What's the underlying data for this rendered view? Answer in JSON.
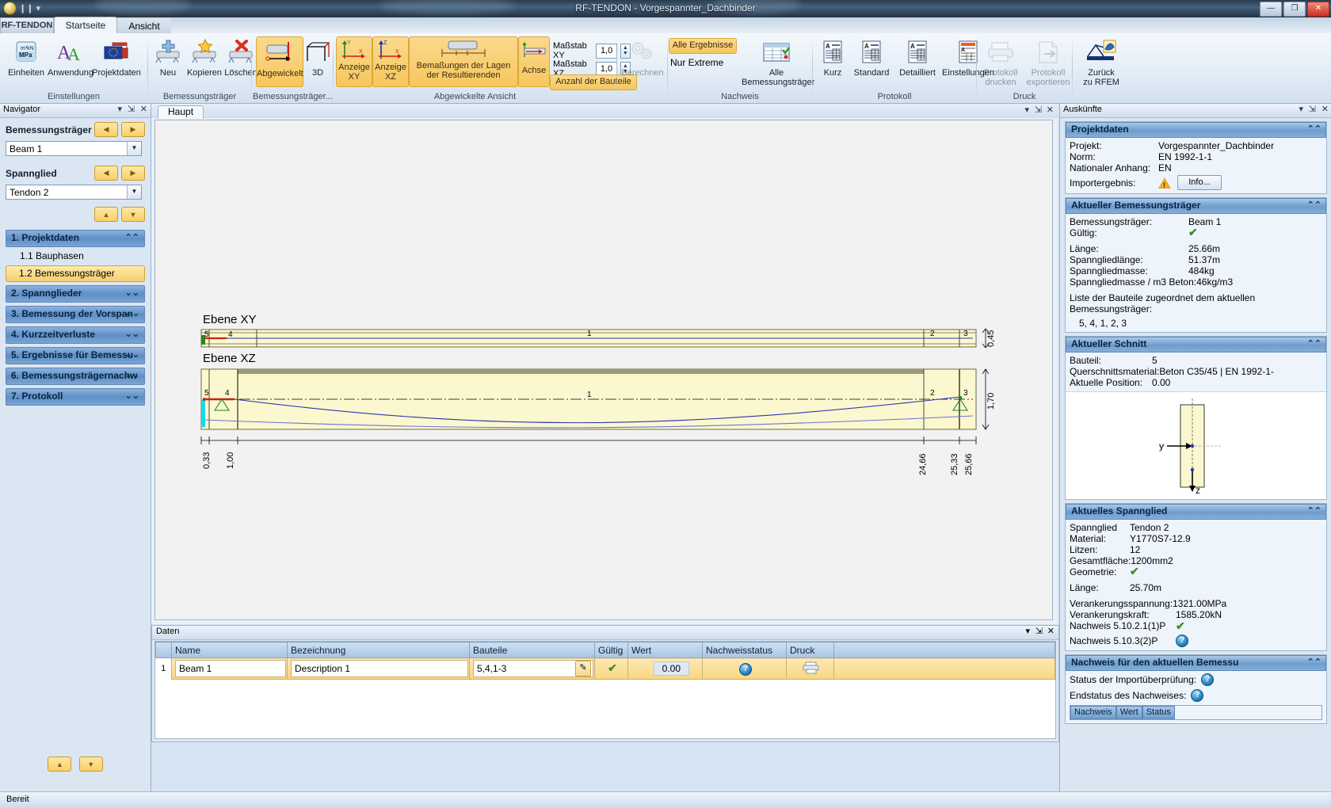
{
  "window": {
    "title": "RF-TENDON - Vorgespannter_Dachbinder",
    "minimize": "—",
    "maximize": "❐",
    "close": "✕"
  },
  "app_tab": "RF-TENDON",
  "tabs": [
    {
      "label": "Startseite",
      "active": true
    },
    {
      "label": "Ansicht",
      "active": false
    }
  ],
  "ribbon": {
    "groups": [
      {
        "label": "Einstellungen"
      },
      {
        "label": "Bemessungsträger"
      },
      {
        "label": "Bemessungsträger..."
      },
      {
        "label": "Abgewickelte Ansicht"
      },
      {
        "label": "Nachweis"
      },
      {
        "label": "Protokoll"
      },
      {
        "label": "Druck"
      }
    ],
    "einheiten": "Einheiten",
    "anwendung": "Anwendung",
    "projektdaten": "Projektdaten",
    "neu": "Neu",
    "kopieren": "Kopieren",
    "loeschen": "Löschen",
    "abgewickelt": "Abgewickelt",
    "dreid": "3D",
    "anzeige_xy": "Anzeige\nXY",
    "anzeige_xy_l1": "Anzeige",
    "anzeige_xy_l2": "XY",
    "anzeige_xz_l1": "Anzeige",
    "anzeige_xz_l2": "XZ",
    "bemassungen_l1": "Bemaßungen der Lagen",
    "bemassungen_l2": "der Resultierenden",
    "achse": "Achse",
    "massstab_xy_label": "Maßstab XY",
    "massstab_xy_value": "1,0",
    "massstab_xz_label": "Maßstab XZ",
    "massstab_xz_value": "1,0",
    "anzahl_bauteile": "Anzahl der Bauteile",
    "berechnen": "Berechnen",
    "alle_ergebnisse": "Alle Ergebnisse",
    "nur_extreme": "Nur Extreme",
    "alle_bt_l1": "Alle",
    "alle_bt_l2": "Bemessungsträger",
    "kurz": "Kurz",
    "standard": "Standard",
    "detailliert": "Detailliert",
    "einstellungen": "Einstellungen",
    "protokoll_drucken_l1": "Protokoll",
    "protokoll_drucken_l2": "drucken",
    "protokoll_export_l1": "Protokoll",
    "protokoll_export_l2": "exportieren",
    "zurueck_l1": "Zurück",
    "zurueck_l2": "zu RFEM"
  },
  "navigator": {
    "title": "Navigator",
    "bemessungstraeger_label": "Bemessungsträger",
    "bemessungstraeger_value": "Beam 1",
    "spannglied_label": "Spannglied",
    "spannglied_value": "Tendon 2",
    "sections": [
      {
        "label": "1. Projektdaten",
        "expanded": true,
        "chev": "≫"
      },
      {
        "label": "2. Spannglieder",
        "expanded": false,
        "chev": "≫"
      },
      {
        "label": "3. Bemessung der Vorspan",
        "expanded": false,
        "chev": "≫"
      },
      {
        "label": "4. Kurzzeitverluste",
        "expanded": false,
        "chev": "≫"
      },
      {
        "label": "5. Ergebnisse für Bemessu",
        "expanded": false,
        "chev": "≫"
      },
      {
        "label": "6. Bemessungsträgernachw",
        "expanded": false,
        "chev": "≫"
      },
      {
        "label": "7. Protokoll",
        "expanded": false,
        "chev": "≫"
      }
    ],
    "items": [
      {
        "label": "1.1  Bauphasen",
        "selected": false
      },
      {
        "label": "1.2 Bemessungsträger",
        "selected": true
      }
    ]
  },
  "document": {
    "tab": "Haupt"
  },
  "drawing": {
    "plane_xy_label": "Ebene XY",
    "plane_xz_label": "Ebene XZ",
    "segment_labels_xy": [
      "5",
      "4",
      "1",
      "2",
      "3"
    ],
    "segment_labels_xz": [
      "5",
      "4",
      "1",
      "2",
      "3"
    ],
    "height_xy": "0,45",
    "height_xz": "1,70",
    "dims_left": [
      "0,33",
      "1,00"
    ],
    "dims_right": [
      "24,66",
      "25,33",
      "25,66"
    ]
  },
  "data_panel": {
    "title": "Daten",
    "columns": [
      "Name",
      "Bezeichnung",
      "Bauteile",
      "Gültig",
      "Wert",
      "Nachweisstatus",
      "Druck"
    ],
    "rows": [
      {
        "no": "1",
        "name": "Beam 1",
        "bezeichnung": "Description 1",
        "bauteile": "5,4,1-3",
        "gueltig": "✔",
        "wert": "0.00",
        "nachweisstatus": "?",
        "druck": "printer-icon"
      }
    ]
  },
  "auskuenfte": {
    "title": "Auskünfte",
    "projektdaten": {
      "header": "Projektdaten",
      "projekt_label": "Projekt:",
      "projekt_value": "Vorgespannter_Dachbinder",
      "norm_label": "Norm:",
      "norm_value": "EN 1992-1-1",
      "anhang_label": "Nationaler Anhang:",
      "anhang_value": "EN",
      "import_label": "Importergebnis:",
      "info_button": "Info..."
    },
    "aktueller_bt": {
      "header": "Aktueller Bemessungsträger",
      "bt_label": "Bemessungsträger:",
      "bt_value": "Beam 1",
      "gueltig_label": "Gültig:",
      "laenge_label": "Länge:",
      "laenge_value": "25.66m",
      "sglaenge_label": "Spanngliedlänge:",
      "sglaenge_value": "51.37m",
      "sgmasse_label": "Spanngliedmasse:",
      "sgmasse_value": "484kg",
      "sgm3_label": "Spanngliedmasse / m3 Beton:",
      "sgm3_value": "46kg/m3",
      "liste_l1": "Liste der Bauteile zugeordnet dem aktuellen",
      "liste_l2": "Bemessungsträger:",
      "liste_value": "5, 4, 1, 2, 3"
    },
    "aktueller_schnitt": {
      "header": "Aktueller Schnitt",
      "bauteil_label": "Bauteil:",
      "bauteil_value": "5",
      "querschnitt_label": "Querschnittsmaterial:",
      "querschnitt_value": "Beton C35/45 | EN 1992-1-",
      "position_label": "Aktuelle Position:",
      "position_value": "0.00",
      "axis_y": "y",
      "axis_z": "z"
    },
    "aktuelles_spannglied": {
      "header": "Aktuelles Spannglied",
      "spannglied_label": "Spannglied",
      "spannglied_value": "Tendon 2",
      "material_label": "Material:",
      "material_value": "Y1770S7-12.9",
      "litzen_label": "Litzen:",
      "litzen_value": "12",
      "flaeche_label": "Gesamtfläche:",
      "flaeche_value": "1200mm2",
      "geometrie_label": "Geometrie:",
      "laenge_label": "Länge:",
      "laenge_value": "25.70m",
      "spannung_label": "Verankerungsspannung:",
      "spannung_value": "1321.00MPa",
      "kraft_label": "Verankerungskraft:",
      "kraft_value": "1585.20kN",
      "nachweis1_label": "Nachweis 5.10.2.1(1)P",
      "nachweis2_label": "Nachweis 5.10.3(2)P"
    },
    "nachweis_card": {
      "header": "Nachweis für den aktuellen Bemessu",
      "import_label": "Status der Importüberprüfung:",
      "endstatus_label": "Endstatus des Nachweises:",
      "col_nachweis": "Nachweis",
      "col_wert": "Wert",
      "col_status": "Status"
    }
  },
  "statusbar": {
    "text": "Bereit"
  },
  "colors": {
    "accent_orange": "#f6c75e",
    "accent_blue": "#6e9ccd",
    "ok_green": "#3f8f20",
    "concrete_fill": "#fbf7cf"
  }
}
